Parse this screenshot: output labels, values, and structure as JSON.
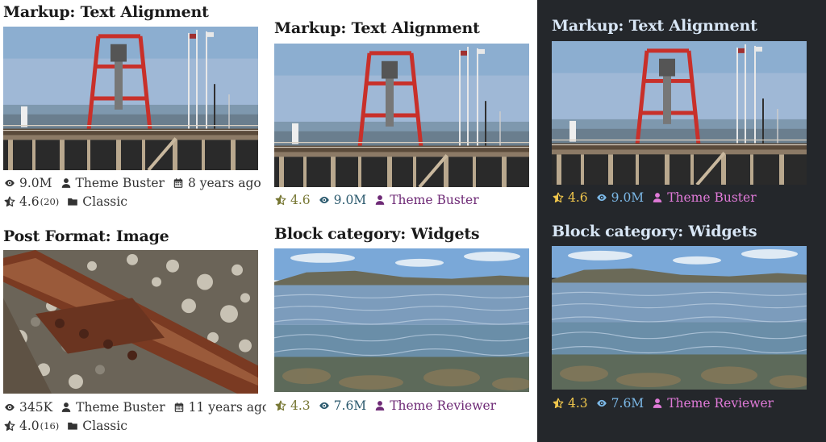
{
  "colors": {
    "dark_bg": "#24272b",
    "light_text": "#1a1a1a",
    "dark_title": "#d8e6f5",
    "olive": "#777733",
    "teal": "#2c5a6e",
    "purple": "#6e2a76",
    "dark_yellow": "#f0c64c",
    "dark_blue": "#7cb9e8",
    "dark_pink": "#e07ad8"
  },
  "left": {
    "card1": {
      "title": "Markup: Text Alignment",
      "image": "pier-with-red-tower",
      "views": "9.0M",
      "author": "Theme Buster",
      "age": "8 years ago",
      "rating": "4.6",
      "rating_count": "(20)",
      "category": "Classic"
    },
    "card2": {
      "title": "Post Format: Image",
      "image": "rusty-rail-on-gravel",
      "views": "345K",
      "author": "Theme Buster",
      "age": "11 years ago",
      "rating": "4.0",
      "rating_count": "(16)",
      "category": "Classic"
    }
  },
  "middle": {
    "card1": {
      "title": "Markup: Text Alignment",
      "image": "pier-with-red-tower",
      "rating": "4.6",
      "views": "9.0M",
      "author": "Theme Buster"
    },
    "card2": {
      "title": "Block category: Widgets",
      "image": "shallow-clear-water-shore",
      "rating": "4.3",
      "views": "7.6M",
      "author": "Theme Reviewer"
    }
  },
  "dark": {
    "card1": {
      "title": "Markup: Text Alignment",
      "image": "pier-with-red-tower",
      "rating": "4.6",
      "views": "9.0M",
      "author": "Theme Buster"
    },
    "card2": {
      "title": "Block category: Widgets",
      "image": "shallow-clear-water-shore",
      "rating": "4.3",
      "views": "7.6M",
      "author": "Theme Reviewer"
    }
  },
  "icons": {
    "views": "eye-icon",
    "author": "user-icon",
    "age": "calendar-icon",
    "rating": "star-half-icon",
    "category": "folder-icon"
  }
}
